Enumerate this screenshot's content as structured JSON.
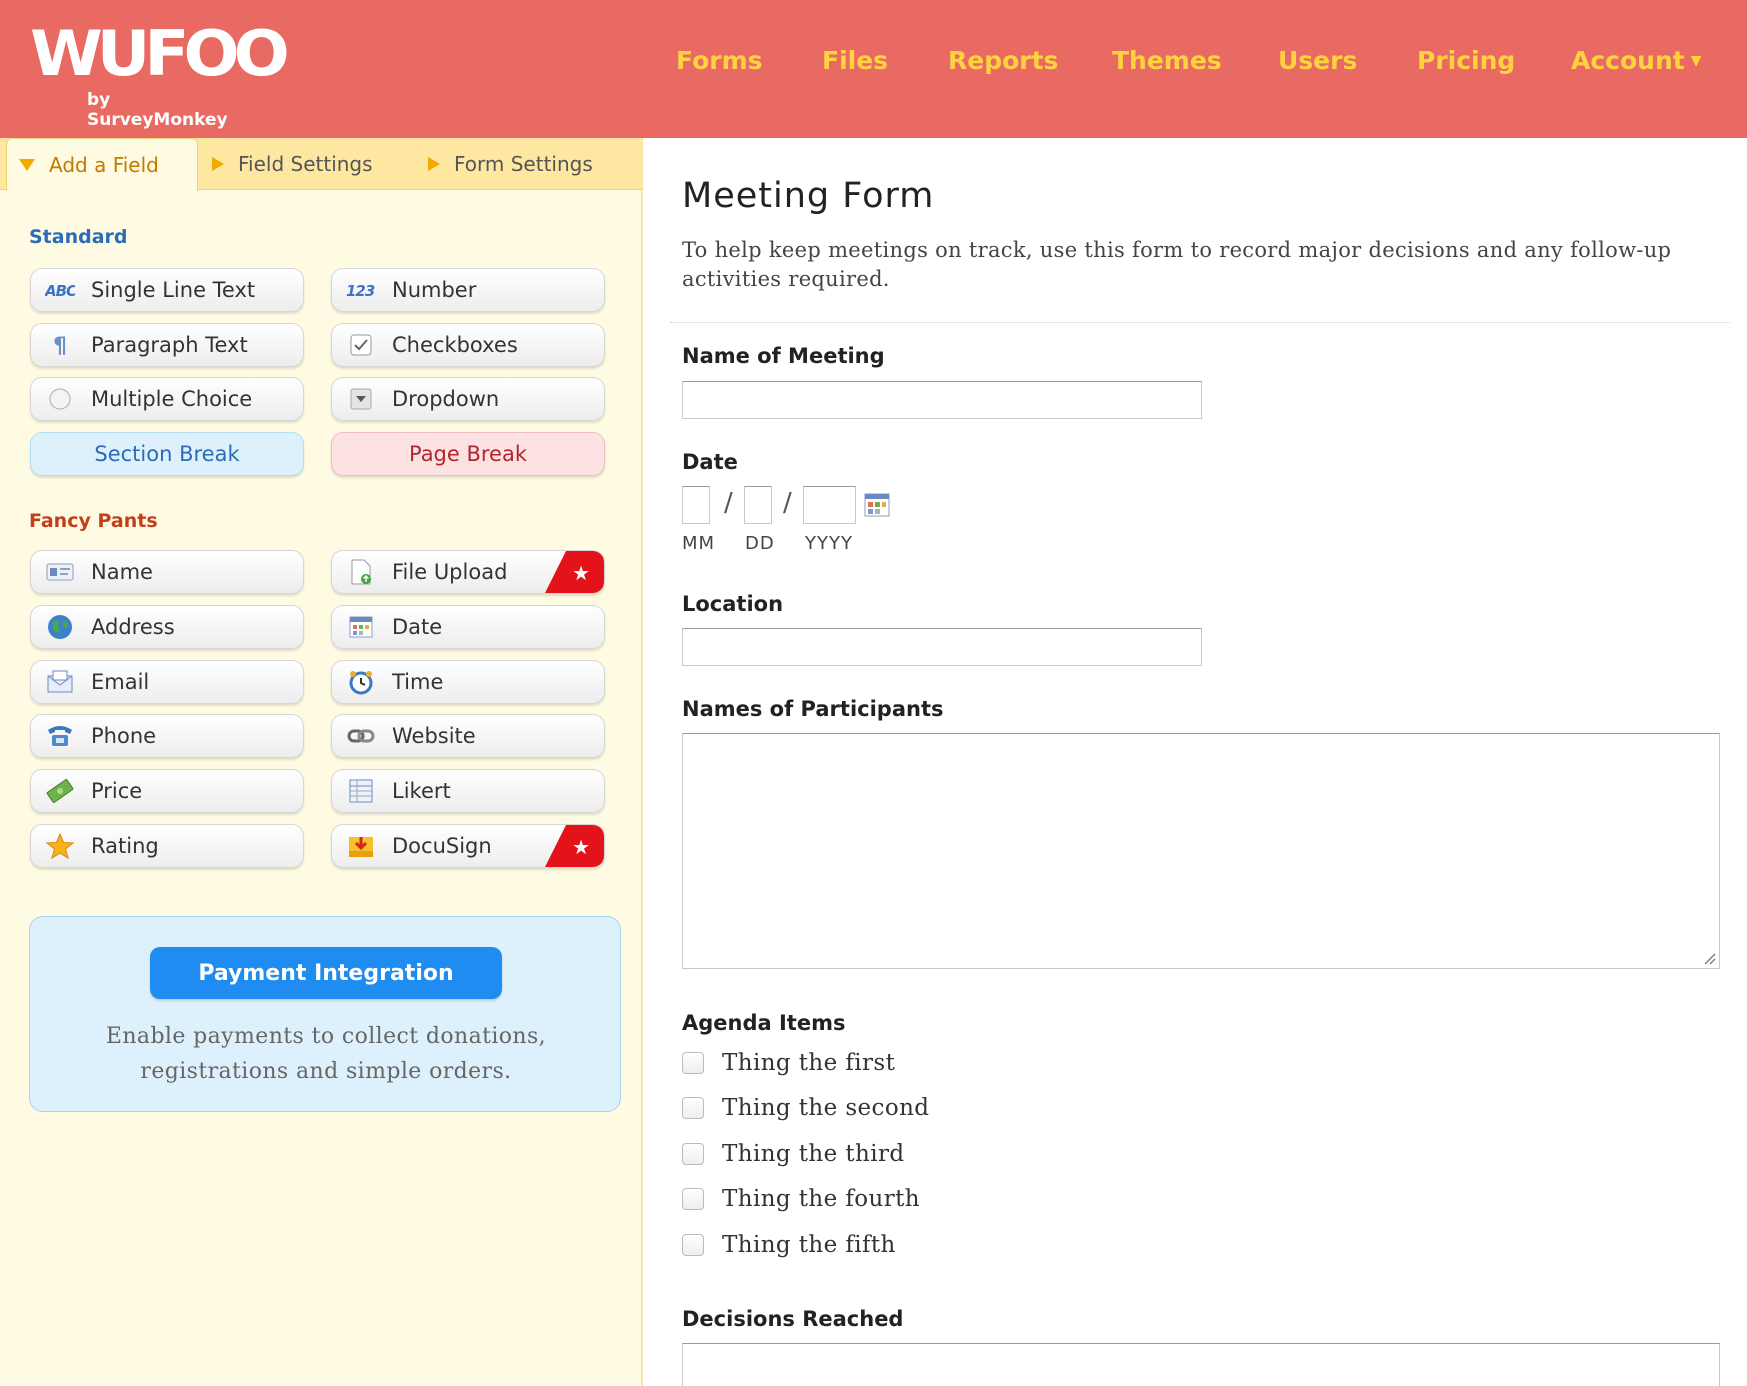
{
  "header": {
    "logo_text": "WUFOO",
    "logo_sub": "by SurveyMonkey",
    "nav": [
      "Forms",
      "Files",
      "Reports",
      "Themes",
      "Users",
      "Pricing",
      "Account"
    ],
    "account_caret": "▼",
    "colors": {
      "bar": "#E96A63",
      "nav_text": "#FFD23E"
    }
  },
  "tabs": [
    {
      "label": "Add a Field",
      "icon": "triangle-down-icon",
      "active": true
    },
    {
      "label": "Field Settings",
      "icon": "triangle-right-icon",
      "active": false
    },
    {
      "label": "Form Settings",
      "icon": "triangle-right-icon",
      "active": false
    }
  ],
  "standard": {
    "heading": "Standard",
    "fields": [
      {
        "label": "Single Line Text",
        "icon": "abc-text-icon"
      },
      {
        "label": "Number",
        "icon": "number-123-icon"
      },
      {
        "label": "Paragraph Text",
        "icon": "pilcrow-icon"
      },
      {
        "label": "Checkboxes",
        "icon": "checkbox-icon"
      },
      {
        "label": "Multiple Choice",
        "icon": "radio-icon"
      },
      {
        "label": "Dropdown",
        "icon": "dropdown-icon"
      },
      {
        "label": "Section Break"
      },
      {
        "label": "Page Break"
      }
    ]
  },
  "fancy": {
    "heading": "Fancy Pants",
    "fields": [
      {
        "label": "Name",
        "icon": "name-card-icon"
      },
      {
        "label": "File Upload",
        "icon": "file-upload-icon",
        "badge": "★"
      },
      {
        "label": "Address",
        "icon": "globe-icon"
      },
      {
        "label": "Date",
        "icon": "calendar-icon"
      },
      {
        "label": "Email",
        "icon": "envelope-icon"
      },
      {
        "label": "Time",
        "icon": "alarm-clock-icon"
      },
      {
        "label": "Phone",
        "icon": "telephone-icon"
      },
      {
        "label": "Website",
        "icon": "chain-link-icon"
      },
      {
        "label": "Price",
        "icon": "money-icon"
      },
      {
        "label": "Likert",
        "icon": "grid-table-icon"
      },
      {
        "label": "Rating",
        "icon": "star-icon"
      },
      {
        "label": "DocuSign",
        "icon": "download-box-icon",
        "badge": "★"
      }
    ]
  },
  "payment": {
    "button": "Payment Integration",
    "desc_line1": "Enable payments to collect donations,",
    "desc_line2": "registrations and simple orders."
  },
  "form": {
    "title": "Meeting Form",
    "description": "To help keep meetings on track, use this form to record major decisions and any follow-up activities required.",
    "fields": {
      "name_of_meeting": {
        "label": "Name of Meeting",
        "value": ""
      },
      "date": {
        "label": "Date",
        "sep": "/",
        "mm": "MM",
        "dd": "DD",
        "yyyy": "YYYY"
      },
      "location": {
        "label": "Location",
        "value": ""
      },
      "participants": {
        "label": "Names of Participants",
        "value": ""
      },
      "agenda": {
        "label": "Agenda Items",
        "options": [
          "Thing the first",
          "Thing the second",
          "Thing the third",
          "Thing the fourth",
          "Thing the fifth"
        ]
      },
      "decisions": {
        "label": "Decisions Reached",
        "value": ""
      }
    }
  }
}
